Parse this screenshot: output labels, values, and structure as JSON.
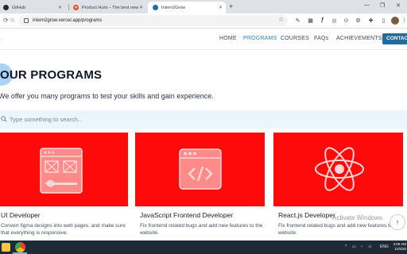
{
  "browser": {
    "tabs": [
      {
        "title": "GitHub",
        "favicon_color": "#24292f",
        "favicon_glyph": ""
      },
      {
        "title": "Product Hunt – The best new",
        "favicon_color": "#da552f",
        "favicon_glyph": "P"
      },
      {
        "title": "Intern2Grow",
        "favicon_color": "#1f6da0",
        "favicon_glyph": ""
      }
    ],
    "new_tab_icon": "plus-icon",
    "url": "intern2grow.vercel.app/programs"
  },
  "site": {
    "nav": [
      "HOME",
      "PROGRAMS",
      "COURSES",
      "FAQs",
      "ACHIEVEMENTS"
    ],
    "active_nav": "PROGRAMS",
    "contact_label": "CONTAC",
    "accent": "#1f6da0"
  },
  "programs": {
    "title": "OUR PROGRAMS",
    "subtitle": "We offer you many programs to test your skills and gain experience.",
    "search_placeholder": "Type something to search..."
  },
  "cards": [
    {
      "title": "UI Developer",
      "desc": "Convert figma designs into web pages, and make sure that everything is responsive.",
      "icon": "ui-design-icon"
    },
    {
      "title": "JavaScript Frontend Developer",
      "desc": "Fix frontend related bugs and add new features to the website.",
      "icon": "code-window-icon"
    },
    {
      "title": "React.js Developer",
      "desc": "Fix frontend related bugs and add new features to the website.",
      "icon": "react-icon"
    }
  ],
  "card_color": "#ff0a0a",
  "watermark": "Activate Windows",
  "taskbar": {
    "lang": "ENG",
    "time": "4:06 AM",
    "date": "11/5/20"
  }
}
